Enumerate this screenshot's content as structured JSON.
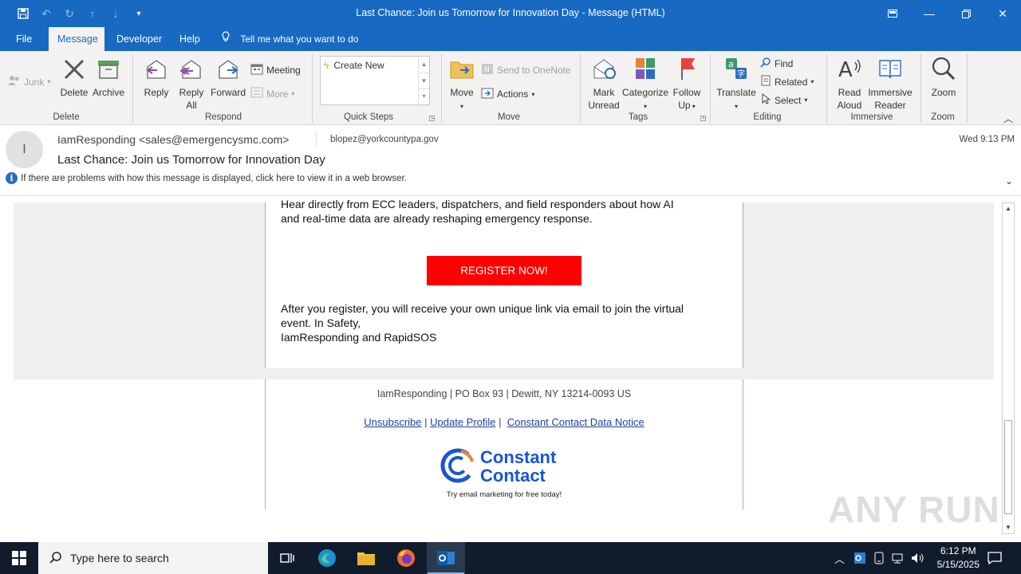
{
  "window": {
    "title": "Last Chance: Join us Tomorrow for Innovation Day  -  Message (HTML)"
  },
  "menu": {
    "tabs": [
      "File",
      "Message",
      "Developer",
      "Help"
    ],
    "active_tab": "Message",
    "tell_me": "Tell me what you want to do"
  },
  "ribbon": {
    "junk": "Junk",
    "delete": "Delete",
    "archive": "Archive",
    "delete_group": "Delete",
    "reply": "Reply",
    "reply_all_1": "Reply",
    "reply_all_2": "All",
    "forward": "Forward",
    "meeting": "Meeting",
    "more": "More",
    "respond_group": "Respond",
    "quick_steps_item": "Create New",
    "quick_steps_group": "Quick Steps",
    "move": "Move",
    "send_to_onenote": "Send to OneNote",
    "actions": "Actions",
    "move_group": "Move",
    "mark_unread_1": "Mark",
    "mark_unread_2": "Unread",
    "categorize": "Categorize",
    "follow_up_1": "Follow",
    "follow_up_2": "Up",
    "tags_group": "Tags",
    "translate": "Translate",
    "find": "Find",
    "related": "Related",
    "select": "Select",
    "editing_group": "Editing",
    "read_aloud_1": "Read",
    "read_aloud_2": "Aloud",
    "immersive_reader_1": "Immersive",
    "immersive_reader_2": "Reader",
    "immersive_group": "Immersive",
    "zoom": "Zoom",
    "zoom_group": "Zoom"
  },
  "message": {
    "avatar_initial": "I",
    "from": "IamResponding <sales@emergencysmc.com>",
    "to": "blopez@yorkcountypa.gov",
    "date": "Wed 9:13 PM",
    "subject": "Last Chance: Join us Tomorrow for Innovation Day",
    "info": "If there are problems with how this message is displayed, click here to view it in a web browser."
  },
  "body": {
    "para1_line1": "Hear directly from ECC leaders, dispatchers, and field responders about how AI",
    "para1_line2": "and real-time data are already reshaping  emergency response.",
    "register_button": "REGISTER NOW!",
    "para2_line1": "After you register, you will receive your own unique  link via email to join the virtual",
    "para2_line2": "event. In Safety,",
    "para2_line3": "IamResponding  and RapidSOS",
    "footer_address": "IamResponding | PO Box 93 | Dewitt, NY 13214-0093 US",
    "link_unsubscribe": "Unsubscribe",
    "link_update_profile": "Update Profile",
    "link_data_notice": "Constant Contact Data Notice",
    "logo_line1": "Constant",
    "logo_line2": "Contact",
    "logo_tagline": "Try email marketing for free today!"
  },
  "watermark": "ANY RUN",
  "taskbar": {
    "search_placeholder": "Type here to search",
    "time": "6:12 PM",
    "date": "5/15/2025"
  }
}
